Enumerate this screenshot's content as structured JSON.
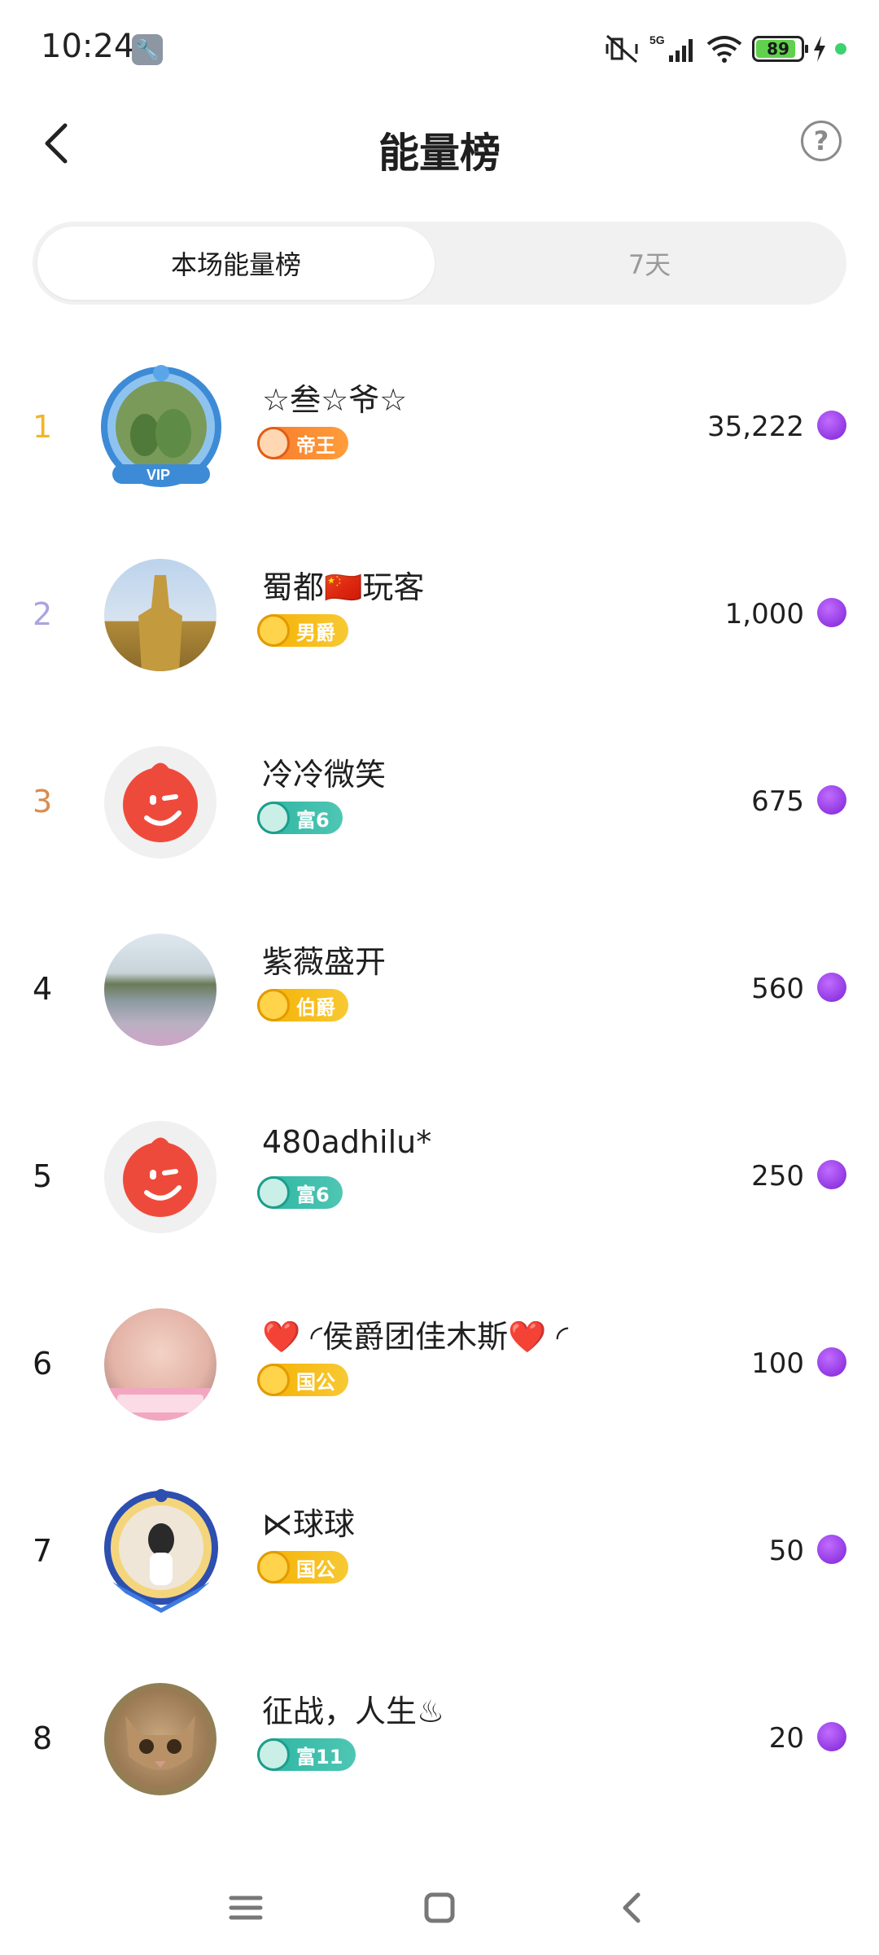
{
  "status": {
    "time": "10:24",
    "battery": "89",
    "network": "5G",
    "battery_level": 0.89
  },
  "header": {
    "title": "能量榜",
    "help_symbol": "?"
  },
  "tabs": [
    {
      "label": "本场能量榜",
      "active": true
    },
    {
      "label": "7天",
      "active": false
    }
  ],
  "rank_colors": {
    "1": "#f2b52c",
    "2": "#a9a4df",
    "3": "#d78c52"
  },
  "list": [
    {
      "rank": "1",
      "name": "☆叁☆爷☆",
      "badge": "帝王",
      "badge_style": "orange",
      "score": "35,222"
    },
    {
      "rank": "2",
      "name": "蜀都🇨🇳玩客",
      "badge": "男爵",
      "badge_style": "gold",
      "score": "1,000"
    },
    {
      "rank": "3",
      "name": "冷冷微笑",
      "badge": "富6",
      "badge_style": "teal",
      "score": "675"
    },
    {
      "rank": "4",
      "name": "紫薇盛开",
      "badge": "伯爵",
      "badge_style": "gold",
      "score": "560"
    },
    {
      "rank": "5",
      "name": "480adhilu*",
      "badge": "富6",
      "badge_style": "teal",
      "score": "250"
    },
    {
      "rank": "6",
      "name": "❤️ ◜侯爵团佳木斯❤️ ◜",
      "badge": "国公",
      "badge_style": "gold",
      "score": "100"
    },
    {
      "rank": "7",
      "name": "⋉球球",
      "badge": "国公",
      "badge_style": "gold",
      "score": "50"
    },
    {
      "rank": "8",
      "name": "征战，人生♨",
      "badge": "富11",
      "badge_style": "teal",
      "score": "20"
    }
  ]
}
